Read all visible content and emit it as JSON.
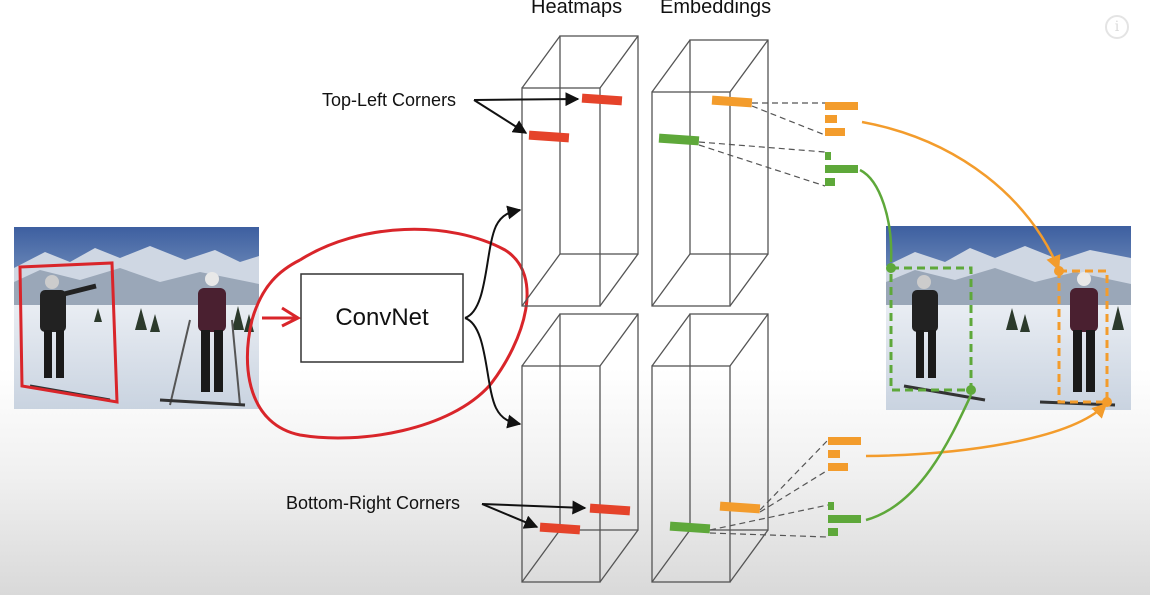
{
  "headings": {
    "heatmaps": "Heatmaps",
    "embeddings": "Embeddings"
  },
  "convnet": {
    "label": "ConvNet"
  },
  "annotations": {
    "top_left": "Top-Left Corners",
    "bottom_right": "Bottom-Right Corners"
  },
  "colors": {
    "heatmap_mark": "#e5432a",
    "embedding_orange": "#f39c2c",
    "embedding_green": "#5ea83a",
    "annotation_red": "#d9252a",
    "box_line": "#555555"
  },
  "icons": {
    "info": "info-icon"
  },
  "info_glyph": "i"
}
